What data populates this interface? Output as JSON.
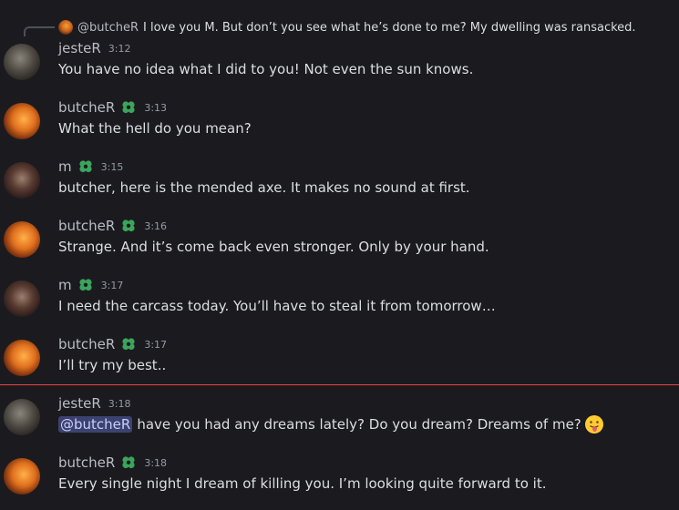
{
  "reply": {
    "author": "@butcheR",
    "text": "I love you M. But don’t you see what he’s done to me? My dwelling was ransacked."
  },
  "messages": [
    {
      "author": "jesteR",
      "time": "3:12",
      "text": "You have no idea what I did to you!  Not even the sun knows.",
      "avatar": "jester",
      "role_icon": false
    },
    {
      "author": "butcheR",
      "time": "3:13",
      "text": "What the hell do you mean?",
      "avatar": "butcher",
      "role_icon": true
    },
    {
      "author": "m",
      "time": "3:15",
      "text": "butcher, here is the mended axe.  It makes no sound at first.",
      "avatar": "m",
      "role_icon": true
    },
    {
      "author": "butcheR",
      "time": "3:16",
      "text": "Strange.  And it’s come back even stronger. Only by your hand.",
      "avatar": "butcher",
      "role_icon": true
    },
    {
      "author": "m",
      "time": "3:17",
      "text": "I need the carcass today.  You’ll have to steal it from tomorrow…",
      "avatar": "m",
      "role_icon": true
    },
    {
      "author": "butcheR",
      "time": "3:17",
      "text": "I’ll try my best..",
      "avatar": "butcher",
      "role_icon": true
    },
    {
      "author": "jesteR",
      "time": "3:18",
      "mention": "@butcheR",
      "text": "have you had any dreams lately?  Do you dream? Dreams of me?",
      "avatar": "jester",
      "role_icon": false,
      "emoji": "face-with-tongue"
    },
    {
      "author": "butcheR",
      "time": "3:18",
      "text": "Every single night I dream of killing you. I’m looking quite forward to it.",
      "avatar": "butcher",
      "role_icon": true
    }
  ],
  "colors": {
    "background": "#1b1b1f",
    "mention_bg": "#3c4270",
    "new_messages_divider": "#f23f42",
    "role_icon": "#3ba55c"
  }
}
